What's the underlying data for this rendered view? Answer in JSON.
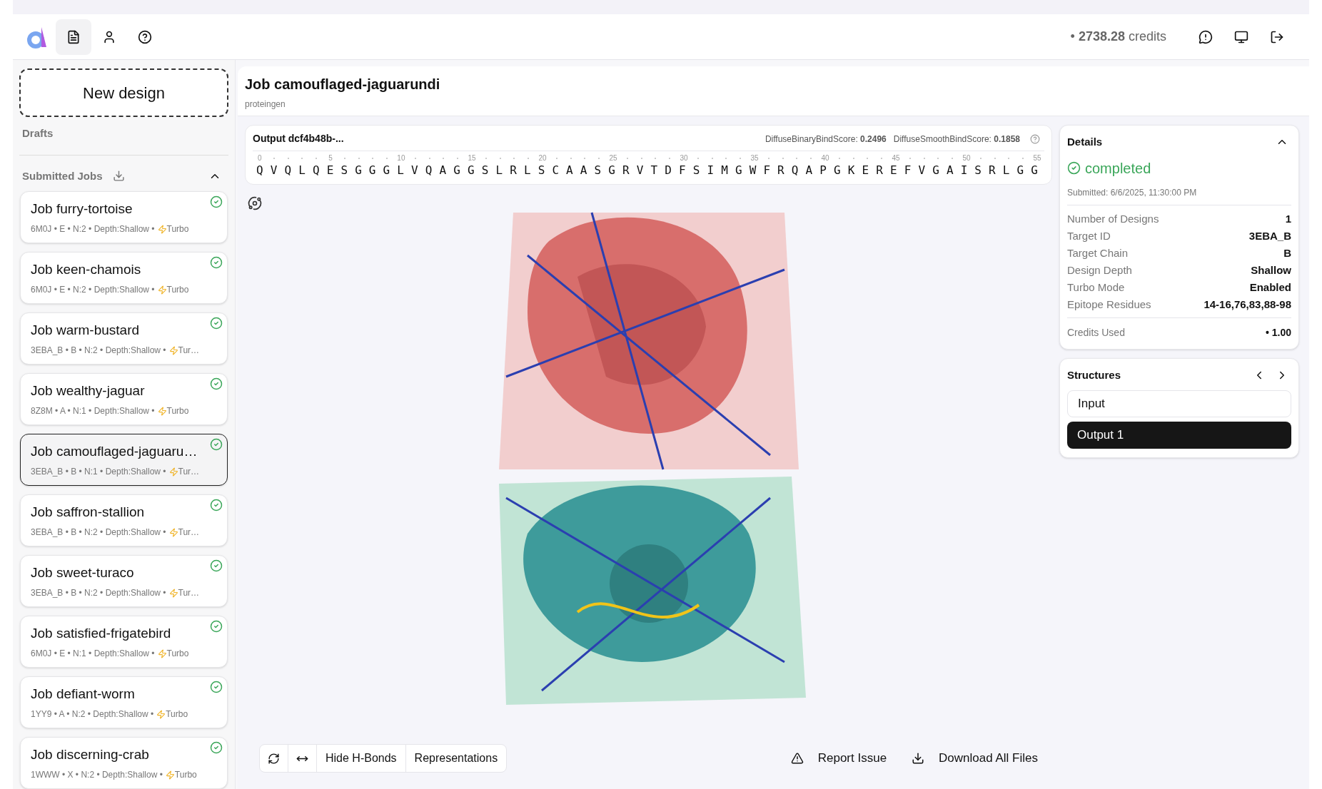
{
  "header": {
    "nav": [
      {
        "selected": true
      },
      {
        "selected": false
      },
      {
        "selected": false
      }
    ],
    "credits": "• **2738.28** credits"
  },
  "sidebar": {
    "new_design": "New design",
    "drafts": "Drafts",
    "submitted_jobs": "Submitted Jobs",
    "expanded": true,
    "jobs": [
      {
        "title": "Job furry-tortoise",
        "meta": "6M0J • E • N:2 • Depth:Shallow •",
        "turbo": "Turbo",
        "selected": false
      },
      {
        "title": "Job keen-chamois",
        "meta": "6M0J • E • N:2 • Depth:Shallow •",
        "turbo": "Turbo",
        "selected": false
      },
      {
        "title": "Job warm-bustard",
        "meta": "3EBA_B • B • N:2 • Depth:Shallow •",
        "turbo": "Tur…",
        "selected": false
      },
      {
        "title": "Job wealthy-jaguar",
        "meta": "8Z8M • A • N:1 • Depth:Shallow •",
        "turbo": "Turbo",
        "selected": false
      },
      {
        "title": "Job camouflaged-jaguaru…",
        "meta": "3EBA_B • B • N:1 • Depth:Shallow •",
        "turbo": "Tur…",
        "selected": true
      },
      {
        "title": "Job saffron-stallion",
        "meta": "3EBA_B • B • N:2 • Depth:Shallow •",
        "turbo": "Tur…",
        "selected": false
      },
      {
        "title": "Job sweet-turaco",
        "meta": "3EBA_B • B • N:2 • Depth:Shallow •",
        "turbo": "Tur…",
        "selected": false
      },
      {
        "title": "Job satisfied-frigatebird",
        "meta": "6M0J • E • N:1 • Depth:Shallow •",
        "turbo": "Turbo",
        "selected": false
      },
      {
        "title": "Job defiant-worm",
        "meta": "1YY9 • A • N:2 • Depth:Shallow •",
        "turbo": "Turbo",
        "selected": false
      },
      {
        "title": "Job discerning-crab",
        "meta": "1WWW • X • N:2 • Depth:Shallow •",
        "turbo": "Turbo",
        "selected": false
      }
    ]
  },
  "job": {
    "title": "Job camouflaged-jaguarundi",
    "subtitle": "proteingen"
  },
  "sequence_card": {
    "title": "Output dcf4b48b-...",
    "scores": [
      "DiffuseBinaryBindScore: **0.2496**",
      "DiffuseSmoothBindScore: **0.1858**"
    ],
    "ticks": [
      "0",
      "5",
      "10",
      "15",
      "20",
      "25",
      "30",
      "35",
      "40",
      "45",
      "50",
      "55"
    ],
    "sequence": "QVQLQESGGGLVQAGGSLRLSCAASGRVTDFSIMGWFRQAPGKEREFVGAISRLGG"
  },
  "viewer": {
    "toolbar": [
      "Hide H-Bonds",
      "Representations"
    ],
    "actions": [
      "Report Issue",
      "Download All Files"
    ]
  },
  "details": {
    "title": "Details",
    "expanded": true,
    "status": "completed",
    "submitted": "Submitted: 6/6/2025, 11:30:00 PM",
    "rows": [
      {
        "label": "Number of Designs",
        "value": "1"
      },
      {
        "label": "Target ID",
        "value": "3EBA_B"
      },
      {
        "label": "Target Chain",
        "value": "B"
      },
      {
        "label": "Design Depth",
        "value": "Shallow"
      },
      {
        "label": "Turbo Mode",
        "value": "Enabled"
      },
      {
        "label": "Epitope Residues",
        "value": "14-16,76,83,88-98"
      }
    ],
    "credits_label": "Credits Used",
    "credits_value": "• 1.00"
  },
  "structures": {
    "title": "Structures",
    "items": [
      {
        "label": "Input",
        "selected": false
      },
      {
        "label": "Output 1",
        "selected": true
      }
    ]
  }
}
